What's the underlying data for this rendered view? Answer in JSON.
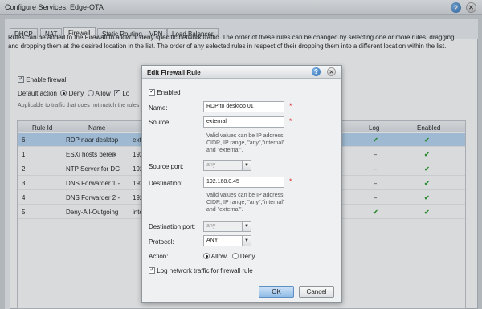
{
  "window": {
    "title": "Configure Services: Edge-OTA"
  },
  "tabs": [
    "DHCP",
    "NAT",
    "Firewall",
    "Static Routing",
    "VPN",
    "Load Balancer"
  ],
  "firewall": {
    "intro": "Rules can be added to the Firewall to allow or deny specific network traffic. The order of these rules can be changed by selecting one or more rules, dragging and dropping them at the desired location in the list. The order of any selected rules in respect of their dropping them into a different location within the list.",
    "enable_label": "Enable firewall",
    "default_action_label": "Default action",
    "deny_label": "Deny",
    "allow_label": "Allow",
    "log_label": "Lo",
    "applicable_text": "Applicable to traffic that does not match the rules"
  },
  "grid": {
    "headers": {
      "rule_id": "Rule Id",
      "name": "Name",
      "log": "Log",
      "enabled": "Enabled"
    },
    "rows": [
      {
        "id": "6",
        "name": "RDP naar desktop",
        "src": "ext",
        "log": "✔",
        "enabled": "✔"
      },
      {
        "id": "1",
        "name": "ESXi hosts bereik",
        "src": "192",
        "log": "–",
        "enabled": "✔"
      },
      {
        "id": "2",
        "name": "NTP Server for DC",
        "src": "192",
        "log": "–",
        "enabled": "✔"
      },
      {
        "id": "3",
        "name": "DNS Forwarder 1 -",
        "src": "192",
        "log": "–",
        "enabled": "✔"
      },
      {
        "id": "4",
        "name": "DNS Forwarder 2 -",
        "src": "192",
        "log": "–",
        "enabled": "✔"
      },
      {
        "id": "5",
        "name": "Deny-All-Outgoing",
        "src": "inte",
        "log": "✔",
        "enabled": "✔"
      }
    ]
  },
  "dialog": {
    "title": "Edit Firewall Rule",
    "enabled_label": "Enabled",
    "name_label": "Name:",
    "name_value": "RDP to desktop 01",
    "source_label": "Source:",
    "source_value": "external",
    "source_hint_1": "Valid values can be IP address,",
    "source_hint_2": "CIDR, IP range, \"any\",\"internal\"",
    "source_hint_3": "and \"external\".",
    "source_port_label": "Source port:",
    "source_port_value": "any",
    "destination_label": "Destination:",
    "destination_value": "192.168.0.45",
    "dest_hint_1": "Valid values can be IP address,",
    "dest_hint_2": "CIDR, IP range, \"any\",\"internal\"",
    "dest_hint_3": "and \"external\".",
    "dest_port_label": "Destination port:",
    "dest_port_value": "any",
    "protocol_label": "Protocol:",
    "protocol_value": "ANY",
    "action_label": "Action:",
    "allow_label": "Allow",
    "deny_label": "Deny",
    "log_label": "Log network traffic for firewall rule",
    "ok_label": "OK",
    "cancel_label": "Cancel",
    "required_mark": "*"
  },
  "icons": {
    "help": "help-icon",
    "close": "close-icon",
    "dropdown": "chevron-down-icon"
  },
  "colors": {
    "selected_row": "#b9d7f2",
    "check_green": "#2a9d2a",
    "required": "#dd2222"
  }
}
